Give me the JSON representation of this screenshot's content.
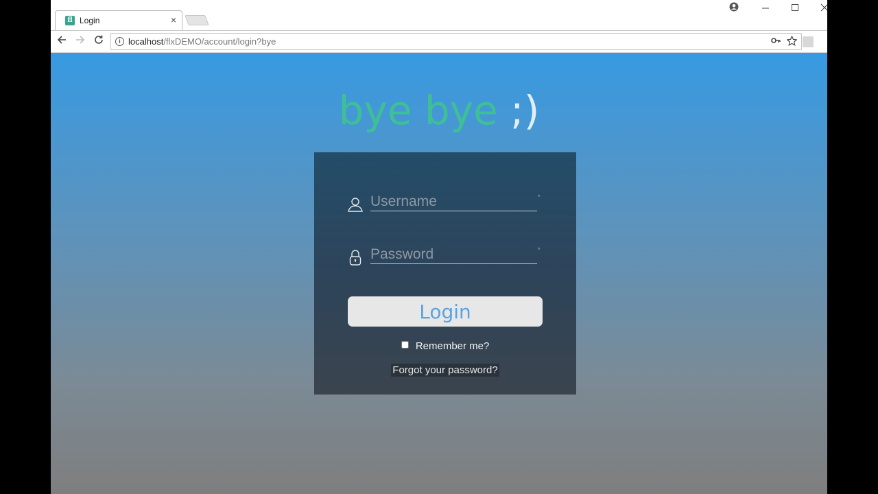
{
  "browser": {
    "tab_title": "Login",
    "tab_favicon": "fl",
    "tab_close": "×",
    "url_host": "localhost",
    "url_path": "/flxDEMO/account/login?bye",
    "icons": {
      "back": "back-arrow-icon",
      "forward": "forward-arrow-icon",
      "reload": "reload-icon",
      "info": "info-icon",
      "key": "key-icon",
      "star": "star-icon",
      "profile": "profile-icon",
      "minimize": "minimize-icon",
      "maximize": "maximize-icon",
      "close": "close-icon"
    }
  },
  "page": {
    "logo_word": "bye bye",
    "logo_smile": ";)",
    "username_placeholder": "Username",
    "password_placeholder": "Password",
    "required_mark": "*",
    "login_label": "Login",
    "remember_label": "Remember me?",
    "remember_checked": false,
    "forgot_label": "Forgot your password?",
    "colors": {
      "logo_green": "#3fbf96",
      "button_text": "#5aa2e2",
      "gradient_top": "#379ae2",
      "gradient_bottom": "#7e7e7e",
      "card_top": "#244d69"
    }
  }
}
